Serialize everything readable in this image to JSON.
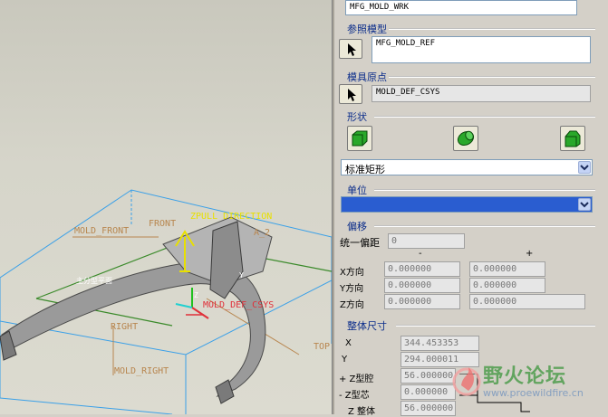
{
  "panel": {
    "top_field_value": "MFG_MOLD_WRK",
    "ref_model": {
      "title": "参照模型",
      "value": "MFG_MOLD_REF"
    },
    "mold_origin": {
      "title": "模具原点",
      "value": "MOLD_DEF_CSYS"
    },
    "shape": {
      "title": "形状",
      "selected": "标准矩形"
    },
    "unit": {
      "title": "单位",
      "selected": ""
    },
    "offset": {
      "title": "偏移",
      "uniform_label": "统一偏距",
      "uniform_value": "0",
      "minus_header": "-",
      "plus_header": "+",
      "rows": [
        {
          "label": "X方向",
          "minus": "0.000000",
          "plus": "0.000000"
        },
        {
          "label": "Y方向",
          "minus": "0.000000",
          "plus": "0.000000"
        },
        {
          "label": "Z方向",
          "minus": "0.000000",
          "plus": "0.000000"
        }
      ]
    },
    "overall": {
      "title": "整体尺寸",
      "rows": [
        {
          "label": "X",
          "value": "344.453353"
        },
        {
          "label": "Y",
          "value": "294.000011"
        },
        {
          "label": "+ Z型腔",
          "value": "56.000000"
        },
        {
          "label": "- Z型芯",
          "value": "0.000000"
        },
        {
          "label": "Z 整体",
          "value": "56.000000"
        }
      ]
    }
  },
  "viewport": {
    "labels": {
      "front": "FRONT",
      "mold_front": "MOLD_FRONT",
      "zpull": "ZPULL DIRECTION",
      "a2": "A_2",
      "right": "RIGHT",
      "mold_right": "MOLD_RIGHT",
      "top": "TOP",
      "csys": "MOLD_DEF_CSYS",
      "parting": "主分型平面",
      "y_axis": "Y",
      "z_axis": "Z"
    }
  },
  "watermark": {
    "title": "野火论坛",
    "url": "www.proewildfire.cn"
  },
  "colors": {
    "section_title": "#0a2c8a",
    "datum_label": "#b8864f",
    "pull_direction": "#e8e000",
    "csys": "#e0303a",
    "box_edge": "#3aa0e8",
    "plane_edge": "#3a8a2a"
  }
}
